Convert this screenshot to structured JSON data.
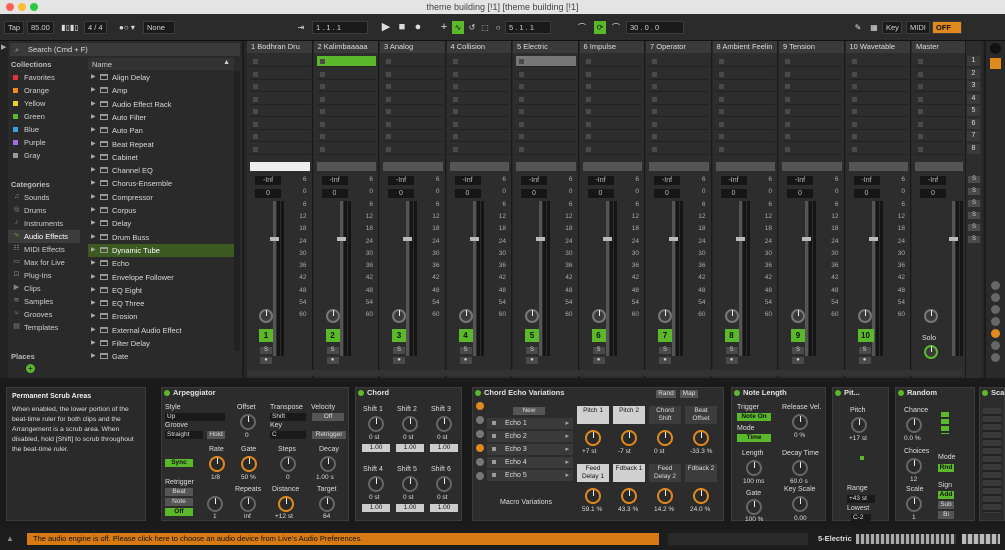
{
  "window": {
    "title": "theme building [!1]  [theme building [!1]"
  },
  "transport": {
    "tap": "Tap",
    "tempo": "85.00",
    "signature": "4 / 4",
    "quantize": "None",
    "position": "1 .  1 .  1",
    "loop_start": "5 .  1 .  1",
    "loop_length": "30 .  0 .  0",
    "key": "Key",
    "midi": "MIDI",
    "off": "OFF"
  },
  "browser": {
    "search_placeholder": "Search (Cmd + F)",
    "collections_label": "Collections",
    "categories_label": "Categories",
    "places_label": "Places",
    "name_header": "Name",
    "collections": [
      {
        "label": "Favorites",
        "color": "#e0323a"
      },
      {
        "label": "Orange",
        "color": "#f08a1c"
      },
      {
        "label": "Yellow",
        "color": "#e8d22a"
      },
      {
        "label": "Green",
        "color": "#5ab82a"
      },
      {
        "label": "Blue",
        "color": "#3aa0e0"
      },
      {
        "label": "Purple",
        "color": "#a070e0"
      },
      {
        "label": "Gray",
        "color": "#9a9a9a"
      }
    ],
    "categories": [
      {
        "label": "Sounds",
        "icon": "sound-icon"
      },
      {
        "label": "Drums",
        "icon": "drum-icon"
      },
      {
        "label": "Instruments",
        "icon": "instrument-icon"
      },
      {
        "label": "Audio Effects",
        "icon": "audio-effect-icon"
      },
      {
        "label": "MIDI Effects",
        "icon": "midi-effect-icon"
      },
      {
        "label": "Max for Live",
        "icon": "max-icon"
      },
      {
        "label": "Plug-Ins",
        "icon": "plugin-icon"
      },
      {
        "label": "Clips",
        "icon": "clip-icon"
      },
      {
        "label": "Samples",
        "icon": "sample-icon"
      },
      {
        "label": "Grooves",
        "icon": "groove-icon"
      },
      {
        "label": "Templates",
        "icon": "template-icon"
      }
    ],
    "items": [
      "Align Delay",
      "Amp",
      "Audio Effect Rack",
      "Auto Filter",
      "Auto Pan",
      "Beat Repeat",
      "Cabinet",
      "Channel EQ",
      "Chorus-Ensemble",
      "Compressor",
      "Corpus",
      "Delay",
      "Drum Buss",
      "Dynamic Tube",
      "Echo",
      "Envelope Follower",
      "EQ Eight",
      "EQ Three",
      "Erosion",
      "External Audio Effect",
      "Filter Delay",
      "Gate"
    ]
  },
  "tracks": [
    {
      "name": "1 Bodhran Dru",
      "num": "1"
    },
    {
      "name": "2 Kalimbaaaaa",
      "num": "2"
    },
    {
      "name": "3 Analog",
      "num": "3"
    },
    {
      "name": "4 Collision",
      "num": "4"
    },
    {
      "name": "5 Electric",
      "num": "5"
    },
    {
      "name": "6 Impulse",
      "num": "6"
    },
    {
      "name": "7 Operator",
      "num": "7"
    },
    {
      "name": "8 Ambient Feelin",
      "num": "8"
    },
    {
      "name": "9 Tension",
      "num": "9"
    },
    {
      "name": "10 Wavetable",
      "num": "10"
    },
    {
      "name": "Master",
      "num": ""
    }
  ],
  "mixer": {
    "inf": "-Inf",
    "zero": "0",
    "solo": "Solo",
    "s": "S",
    "scale": [
      "6",
      "0",
      "6",
      "12",
      "18",
      "24",
      "30",
      "36",
      "42",
      "48",
      "54",
      "60"
    ]
  },
  "scenes": [
    "1",
    "2",
    "3",
    "4",
    "5",
    "6",
    "7",
    "8"
  ],
  "info": {
    "title": "Permanent Scrub Areas",
    "text": "When enabled, the lower portion of the beat-time ruler for both clips and the Arrangement is a scrub area. When disabled, hold [Shift] to scrub throughout the beat-time ruler."
  },
  "arpeggiator": {
    "title": "Arpeggiator",
    "style_label": "Style",
    "style_value": "Up",
    "groove_label": "Groove",
    "groove_value": "Straight",
    "hold": "Hold",
    "offset_label": "Offset",
    "offset_value": "0",
    "transpose_label": "Transpose",
    "transpose_value": "Shift",
    "key_label": "Key",
    "key_value": "C",
    "velocity_label": "Velocity",
    "velocity_value": "Off",
    "retrigger_btn": "Retrigger",
    "sync": "Sync",
    "rate_label": "Rate",
    "rate_value": "1/8",
    "gate_label": "Gate",
    "gate_value": "50 %",
    "steps_label": "Steps",
    "steps_value": "0",
    "decay_label": "Decay",
    "decay_value": "1.00 s",
    "retrigger_label": "Retrigger",
    "beat": "Beat",
    "note": "Note",
    "off": "Off",
    "retrig_value": "1",
    "repeats_label": "Repeats",
    "repeats_value": "inf",
    "distance_label": "Distance",
    "distance_value": "+12 st",
    "target_label": "Target",
    "target_value": "64"
  },
  "chord": {
    "title": "Chord",
    "shifts": [
      {
        "label": "Shift 1",
        "value": "0 st",
        "amount": "1.00"
      },
      {
        "label": "Shift 2",
        "value": "0 st",
        "amount": "1.00"
      },
      {
        "label": "Shift 3",
        "value": "0 st",
        "amount": "1.00"
      },
      {
        "label": "Shift 4",
        "value": "0 st",
        "amount": "1.00"
      },
      {
        "label": "Shift 5",
        "value": "0 st",
        "amount": "1.00"
      },
      {
        "label": "Shift 6",
        "value": "0 st",
        "amount": "1.00"
      }
    ]
  },
  "echo": {
    "title": "Chord Echo Variations",
    "rand": "Rand",
    "map": "Map",
    "new": "New",
    "items": [
      "Echo 1",
      "Echo 2",
      "Echo 3",
      "Echo 4",
      "Echo 5"
    ],
    "macro": "Macro Variations",
    "macros": [
      {
        "label": "Pitch 1",
        "value": "+7 st"
      },
      {
        "label": "Pitch 2",
        "value": "-7 st"
      },
      {
        "label": "Chord Shift",
        "value": "0 st"
      },
      {
        "label": "Beat Offset",
        "value": "-33.3 %"
      },
      {
        "label": "Feed Delay 1",
        "value": "59.1 %"
      },
      {
        "label": "Fdback 1",
        "value": "43.3 %"
      },
      {
        "label": "Feed Delay 2",
        "value": "14.2 %"
      },
      {
        "label": "Fdback 2",
        "value": "24.0 %"
      }
    ]
  },
  "notelength": {
    "title": "Note Length",
    "trigger_label": "Trigger",
    "trigger_value": "Note On",
    "mode_label": "Mode",
    "mode_value": "Time",
    "release_label": "Release Vel.",
    "release_value": "0 %",
    "length_label": "Length",
    "length_value": "100 ms",
    "decay_label": "Decay Time",
    "decay_value": "60.0 s",
    "gate_label": "Gate",
    "gate_value": "100 %",
    "keyscale_label": "Key Scale",
    "keyscale_value": "0.00"
  },
  "pitch": {
    "title": "Pit...",
    "pitch_label": "Pitch",
    "pitch_value": "+17 st",
    "range_label": "Range",
    "range_value": "+43 st",
    "lowest_label": "Lowest",
    "lowest_value": "C-2"
  },
  "random": {
    "title": "Random",
    "chance_label": "Chance",
    "chance_value": "0.0 %",
    "choices_label": "Choices",
    "choices_value": "12",
    "scale_label": "Scale",
    "scale_value": "1",
    "mode_label": "Mode",
    "mode_value": "Rnd",
    "sign_label": "Sign",
    "add": "Add",
    "sub": "Sub",
    "bi": "Bi"
  },
  "scale_dev": {
    "title": "Scal"
  },
  "status": {
    "message": "The audio engine is off. Please click here to choose an audio device from Live's Audio Preferences.",
    "track": "5-Electric"
  }
}
